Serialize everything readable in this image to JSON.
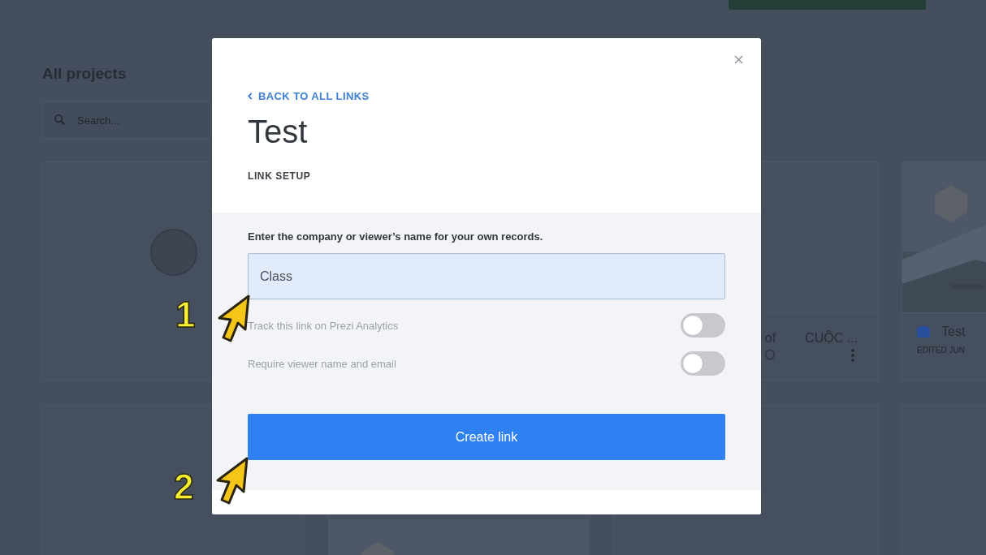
{
  "page": {
    "heading": "All projects",
    "search": {
      "placeholder": "Search..."
    },
    "cards": [
      {
        "kind": "placeholder"
      },
      {
        "kind": "cut",
        "fragment": "of",
        "title": "CUỘC ..."
      },
      {
        "kind": "project",
        "title": "Test",
        "meta": "EDITED JUN"
      },
      {
        "kind": "blank"
      },
      {
        "kind": "bottom-picture"
      },
      {
        "kind": "blank"
      },
      {
        "kind": "blank"
      }
    ]
  },
  "dialog": {
    "back_link": "BACK TO ALL LINKS",
    "title": "Test",
    "section": "LINK SETUP",
    "field": {
      "label": "Enter the company or viewer’s name for your own records.",
      "value": "Class"
    },
    "toggles": [
      {
        "label": "Track this link on Prezi Analytics",
        "on": false
      },
      {
        "label": "Require viewer name and email",
        "on": false
      }
    ],
    "button": "Create link"
  },
  "annotations": [
    {
      "label": "1"
    },
    {
      "label": "2"
    }
  ]
}
